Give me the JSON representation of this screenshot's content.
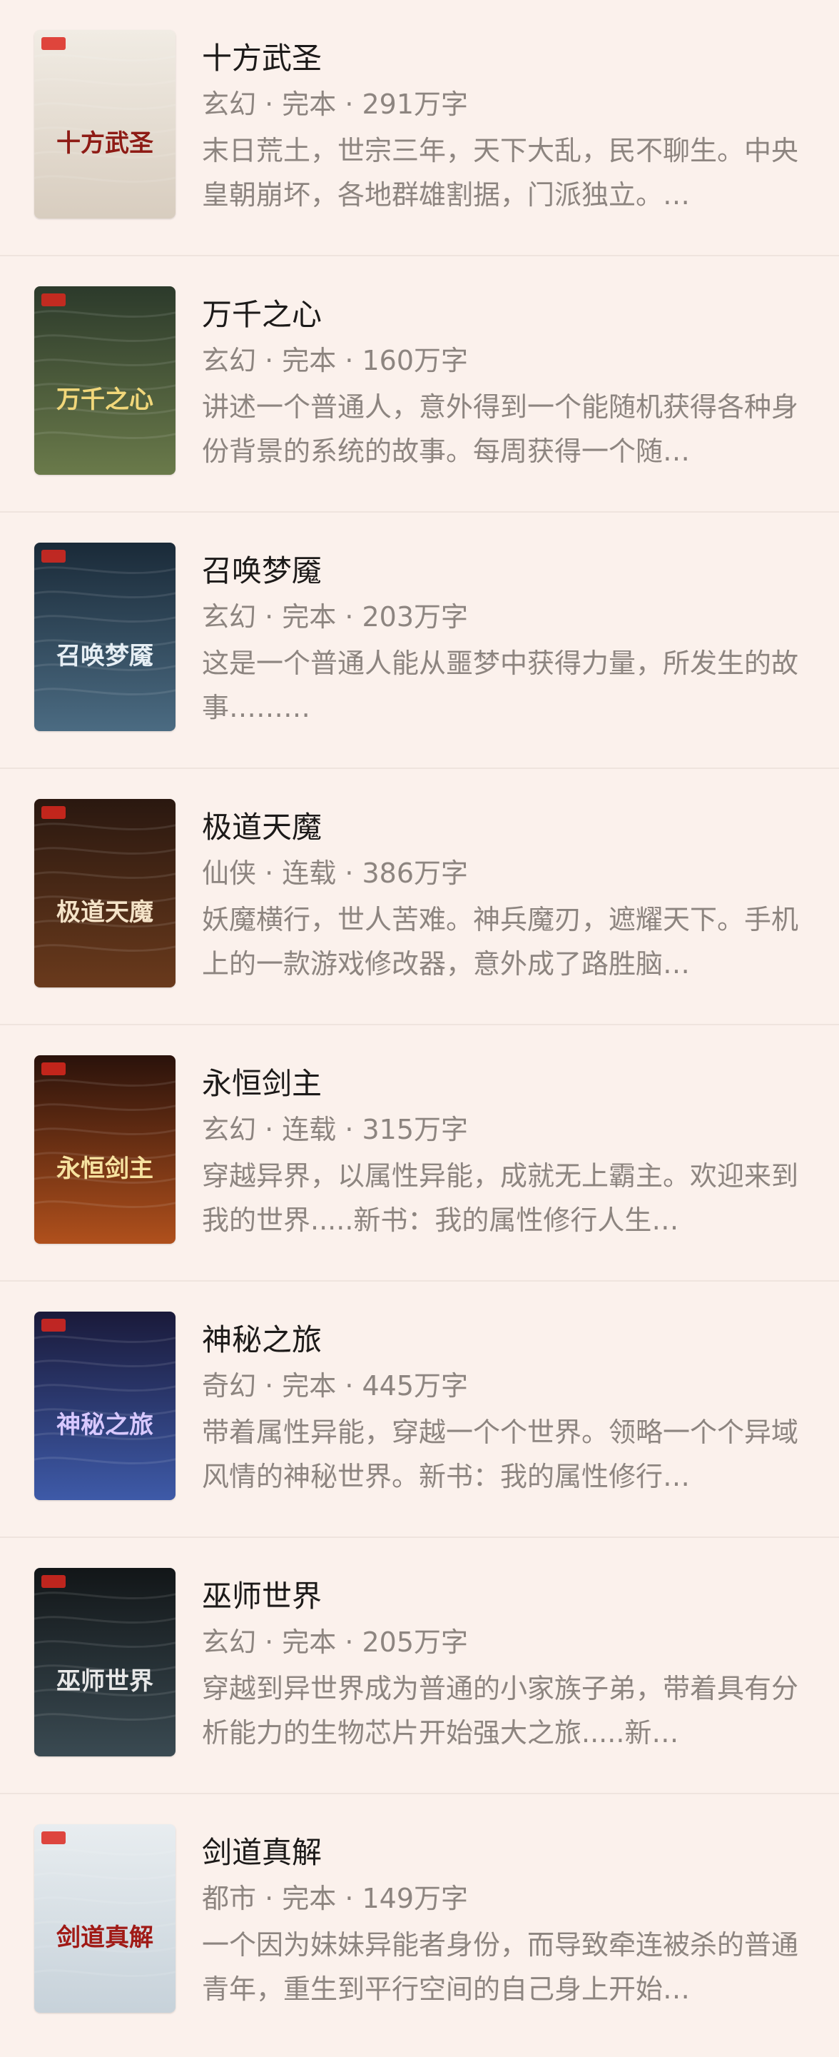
{
  "books": [
    {
      "title": "十方武圣",
      "meta": "玄幻 · 完本 · 291万字",
      "desc": "末日荒土，世宗三年，天下大乱，民不聊生。中央皇朝崩坏，各地群雄割据，门派独立。…",
      "cover": {
        "icon": "book-cover",
        "text": "十方武圣",
        "bg_top": "#f1ece4",
        "bg_bottom": "#d8cdbf",
        "text_color": "#8e1b15"
      }
    },
    {
      "title": "万千之心",
      "meta": "玄幻 · 完本 · 160万字",
      "desc": "讲述一个普通人，意外得到一个能随机获得各种身份背景的系统的故事。每周获得一个随…",
      "cover": {
        "icon": "book-cover",
        "text": "万千之心",
        "bg_top": "#2c3a2b",
        "bg_bottom": "#6a7a4a",
        "text_color": "#f1d77a"
      }
    },
    {
      "title": "召唤梦魇",
      "meta": "玄幻 · 完本 · 203万字",
      "desc": "这是一个普通人能从噩梦中获得力量，所发生的故事………",
      "cover": {
        "icon": "book-cover",
        "text": "召唤梦魇",
        "bg_top": "#1a2a38",
        "bg_bottom": "#4b6b82",
        "text_color": "#e6eef4"
      }
    },
    {
      "title": "极道天魔",
      "meta": "仙侠 · 连载 · 386万字",
      "desc": "妖魔横行，世人苦难。神兵魔刃，遮耀天下。手机上的一款游戏修改器，意外成了路胜脑…",
      "cover": {
        "icon": "book-cover",
        "text": "极道天魔",
        "bg_top": "#2a1810",
        "bg_bottom": "#6a3a1c",
        "text_color": "#f4e3c8"
      }
    },
    {
      "title": "永恒剑主",
      "meta": "玄幻 · 连载 · 315万字",
      "desc": "穿越异界，以属性异能，成就无上霸主。欢迎来到我的世界.....新书：我的属性修行人生…",
      "cover": {
        "icon": "book-cover",
        "text": "永恒剑主",
        "bg_top": "#2a120b",
        "bg_bottom": "#b0501c",
        "text_color": "#f6e2a0"
      }
    },
    {
      "title": "神秘之旅",
      "meta": "奇幻 · 完本 · 445万字",
      "desc": "带着属性异能，穿越一个个世界。领略一个个异域风情的神秘世界。新书：我的属性修行…",
      "cover": {
        "icon": "book-cover",
        "text": "神秘之旅",
        "bg_top": "#1a1a3a",
        "bg_bottom": "#3e5aa8",
        "text_color": "#d8c8ff"
      }
    },
    {
      "title": "巫师世界",
      "meta": "玄幻 · 完本 · 205万字",
      "desc": "穿越到异世界成为普通的小家族子弟，带着具有分析能力的生物芯片开始强大之旅.....新…",
      "cover": {
        "icon": "book-cover",
        "text": "巫师世界",
        "bg_top": "#121618",
        "bg_bottom": "#3a4a52",
        "text_color": "#e8e8e8"
      }
    },
    {
      "title": "剑道真解",
      "meta": "都市 · 完本 · 149万字",
      "desc": "一个因为妹妹异能者身份，而导致牵连被杀的普通青年，重生到平行空间的自己身上开始…",
      "cover": {
        "icon": "book-cover",
        "text": "剑道真解",
        "bg_top": "#e8edf0",
        "bg_bottom": "#c7d2da",
        "text_color": "#a01a16"
      }
    }
  ]
}
